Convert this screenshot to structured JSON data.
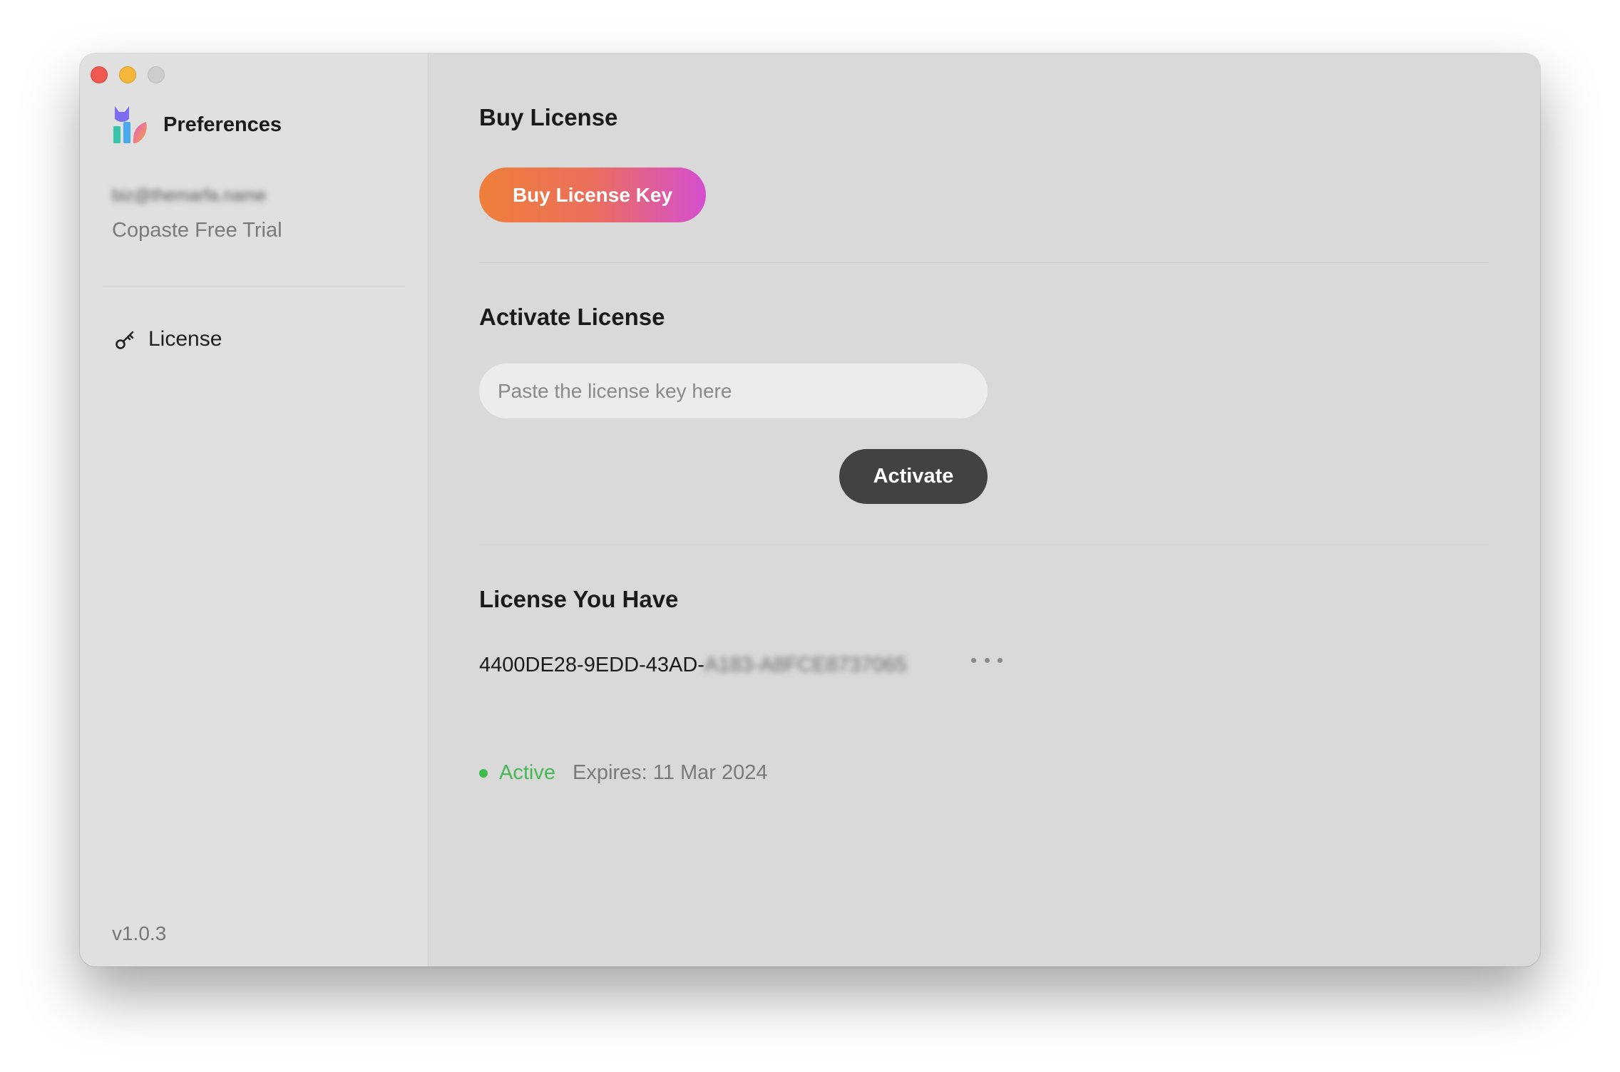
{
  "app": {
    "title": "Preferences",
    "account_email": "biz@themarfa.name",
    "plan": "Copaste Free Trial",
    "version": "v1.0.3"
  },
  "sidebar": {
    "items": [
      {
        "label": "License",
        "icon": "key-icon"
      }
    ]
  },
  "buy_section": {
    "title": "Buy License",
    "button_label": "Buy License Key",
    "gradient": [
      "#ee7f3a",
      "#d54ed0"
    ]
  },
  "activate_section": {
    "title": "Activate License",
    "input_placeholder": "Paste the license key here",
    "input_value": "",
    "button_label": "Activate"
  },
  "owned_section": {
    "title": "License You Have",
    "license_key_visible": "4400DE28-9EDD-43AD-",
    "license_key_hidden": "A183-A8FCE8737065",
    "status": "Active",
    "status_color": "#3dbb4d",
    "expires": "Expires: 11 Mar 2024"
  },
  "colors": {
    "accent_dark": "#424242",
    "window_bg": "#d9d9d9",
    "sidebar_bg": "#e0e0e0"
  }
}
